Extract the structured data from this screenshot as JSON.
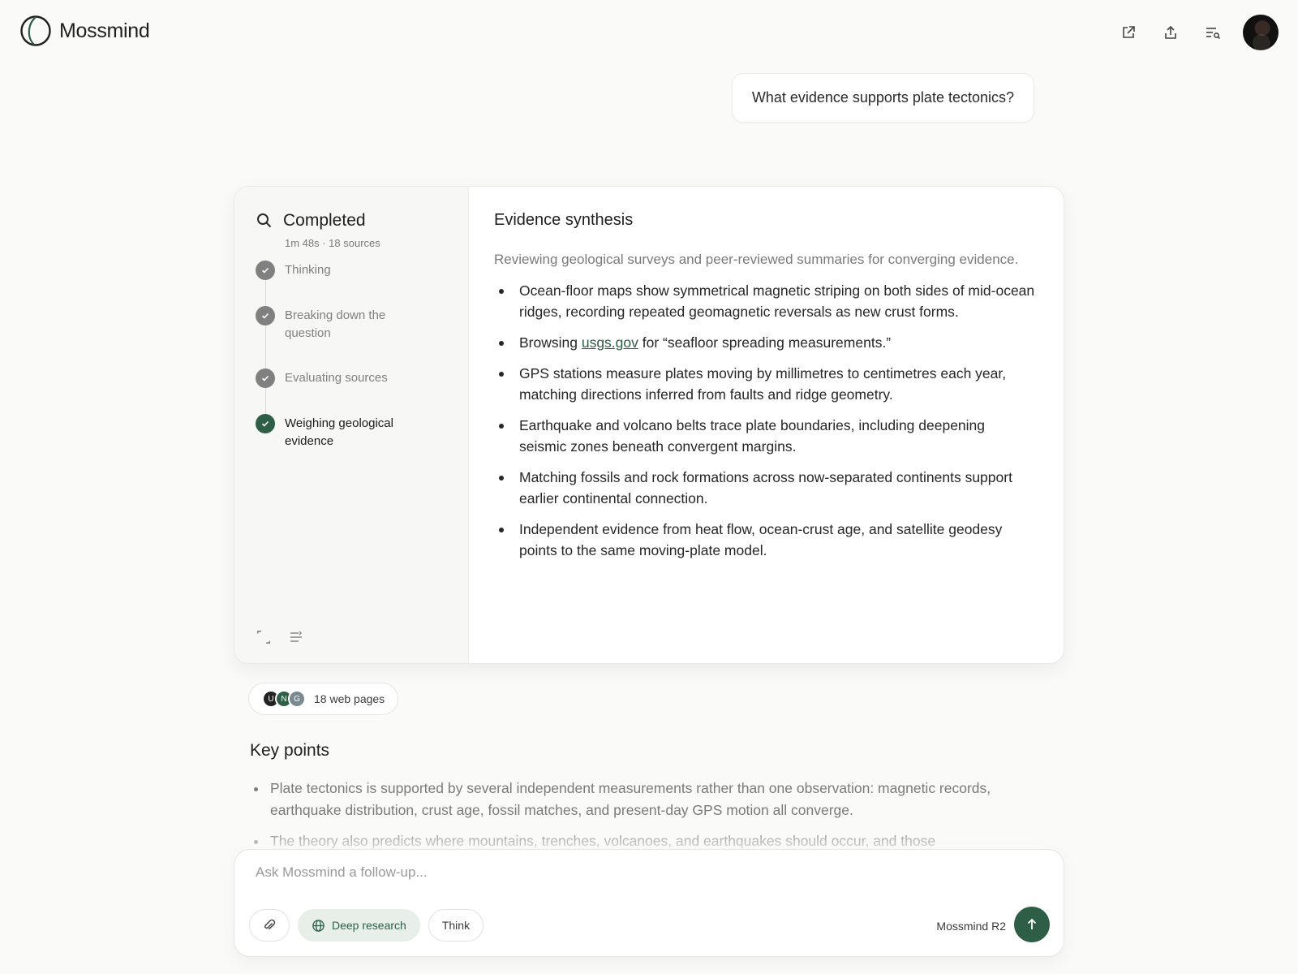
{
  "app": {
    "name": "Mossmind"
  },
  "conversation": {
    "user_message": "What evidence supports plate tectonics?"
  },
  "research": {
    "status_title": "Completed",
    "status_meta": "1m 48s · 18 sources",
    "steps": [
      {
        "label": "Thinking",
        "state": "done"
      },
      {
        "label": "Breaking down the question",
        "state": "done"
      },
      {
        "label": "Evaluating sources",
        "state": "done"
      },
      {
        "label": "Weighing geological evidence",
        "state": "active"
      }
    ],
    "synthesis_title": "Evidence synthesis",
    "synthesis_intro": "Reviewing geological surveys and peer-reviewed summaries for converging evidence.",
    "bullets": [
      "Ocean-floor maps show symmetrical magnetic striping on both sides of mid-ocean ridges, recording repeated geomagnetic reversals as new crust forms.",
      {
        "prefix": "Browsing ",
        "link": "usgs.gov",
        "suffix": " for “seafloor spreading measurements.”"
      },
      "GPS stations measure plates moving by millimetres to centimetres each year, matching directions inferred from faults and ridge geometry.",
      "Earthquake and volcano belts trace plate boundaries, including deepening seismic zones beneath convergent margins.",
      "Matching fossils and rock formations across now-separated continents support earlier continental connection.",
      "Independent evidence from heat flow, ocean-crust age, and satellite geodesy points to the same moving-plate model."
    ]
  },
  "sources": {
    "label": "18 web pages",
    "icons": [
      {
        "letter": "U",
        "color": "#222222"
      },
      {
        "letter": "N",
        "color": "#2f5e47"
      },
      {
        "letter": "G",
        "color": "#7a8a90"
      }
    ]
  },
  "key_points": {
    "title": "Key points",
    "items": [
      "Plate tectonics is supported by several independent measurements rather than one observation: magnetic records, earthquake distribution, crust age, fossil matches, and present-day GPS motion all converge.",
      "The theory also predicts where mountains, trenches, volcanoes, and earthquakes should occur, and those"
    ]
  },
  "composer": {
    "placeholder": "Ask Mossmind a follow-up...",
    "deep_research_label": "Deep research",
    "think_label": "Think",
    "model_label": "Mossmind R2"
  },
  "colors": {
    "accent": "#2f5e47",
    "step_done": "#808080"
  }
}
